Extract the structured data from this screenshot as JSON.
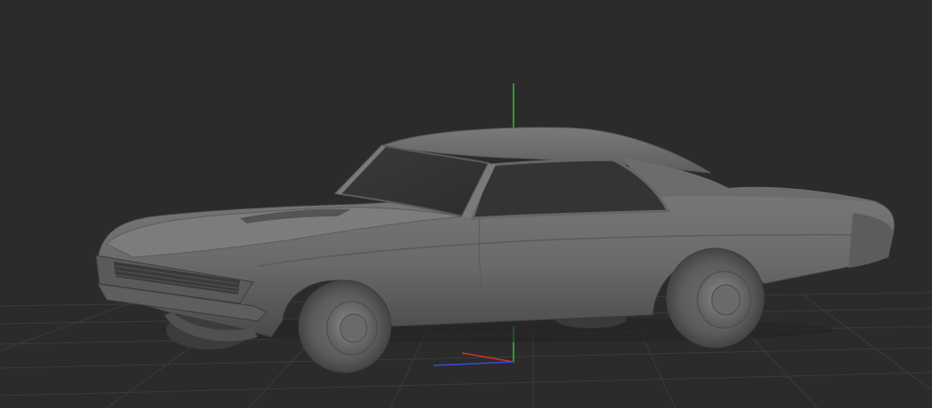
{
  "viewport": {
    "background": "#2b2b2b",
    "grid_color": "#3a3a3a",
    "mode": "3d-perspective",
    "shading": "solid-grey"
  },
  "scene": {
    "object": "car-model",
    "object_color": "#6b6b6b",
    "gizmo": {
      "x_axis_color": "#d23232",
      "y_axis_color": "#2fbf2f",
      "z_axis_color": "#3a4bd8"
    }
  }
}
